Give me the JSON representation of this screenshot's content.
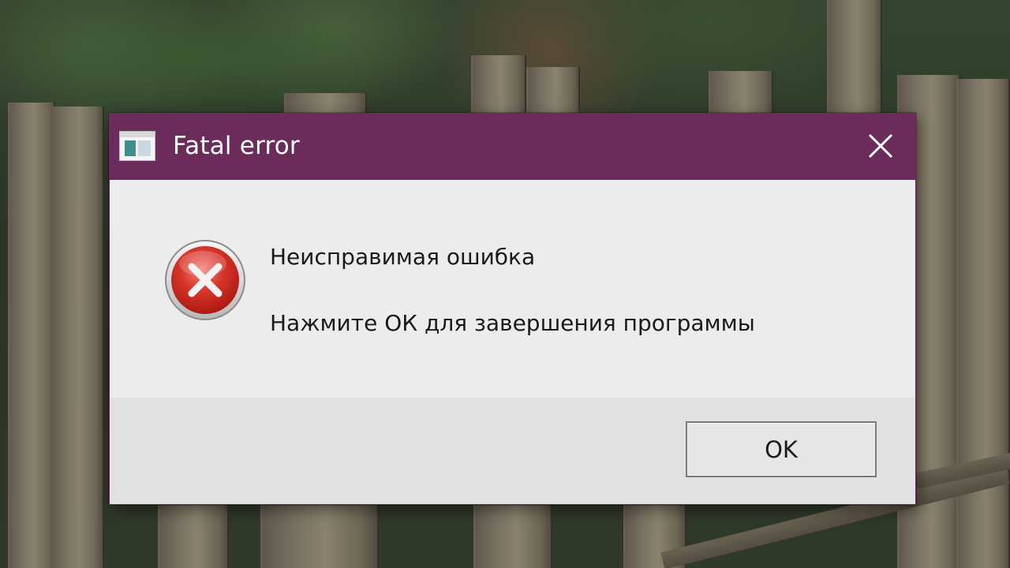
{
  "dialog": {
    "title": "Fatal error",
    "heading": "Неисправимая ошибка",
    "message": "Нажмите ОК для завершения программы",
    "ok_label": "OK",
    "titlebar_color": "#6b2c5c",
    "body_color": "#ececec",
    "footer_color": "#e1e1e1",
    "icon": "error-x-icon",
    "close_icon": "close-icon",
    "app_icon": "app-window-icon"
  }
}
